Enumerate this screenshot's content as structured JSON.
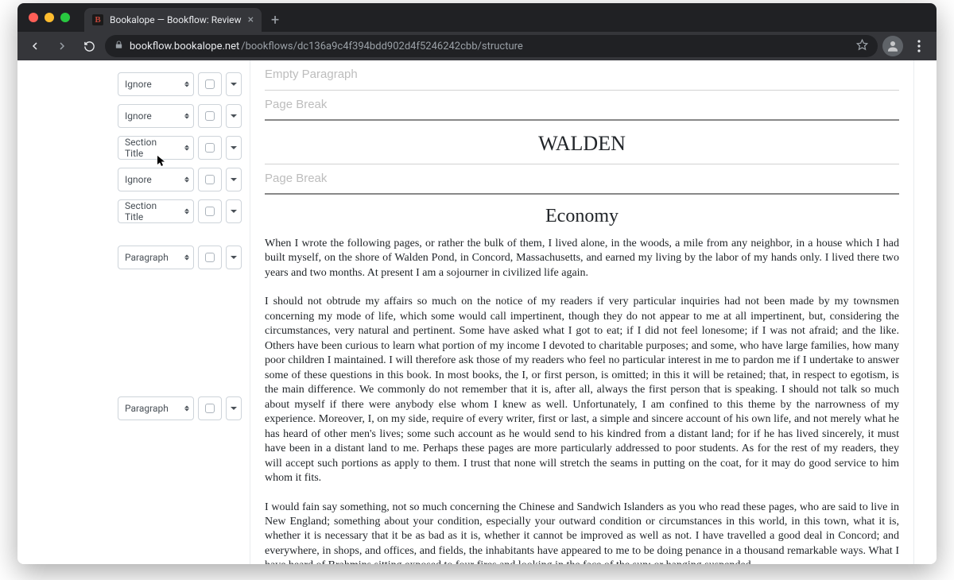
{
  "browser": {
    "tab_title": "Bookalope — Bookflow: Review",
    "url_host": "bookflow.bookalope.net",
    "url_path": "/bookflows/dc136a9c4f394bdd902d4f5246242cbb/structure"
  },
  "sidebar": {
    "rows": [
      {
        "label": "Ignore"
      },
      {
        "label": "Ignore"
      },
      {
        "label": "Section Title"
      },
      {
        "label": "Ignore"
      },
      {
        "label": "Section Title"
      },
      {
        "label": "Paragraph"
      },
      {
        "label": "Paragraph"
      }
    ]
  },
  "doc": {
    "empty_para_label": "Empty Paragraph",
    "page_break_label": "Page Break",
    "book_title": "WALDEN",
    "chapter_title": "Economy",
    "para1": "When I wrote the following pages, or rather the bulk of them, I lived alone, in the woods, a mile from any neighbor, in a house which I had built myself, on the shore of Walden Pond, in Concord, Massachusetts, and earned my living by the labor of my hands only. I lived there two years and two months. At present I am a sojourner in civilized life again.",
    "para2": "I should not obtrude my affairs so much on the notice of my readers if very particular inquiries had not been made by my townsmen concerning my mode of life, which some would call impertinent, though they do not appear to me at all impertinent, but, considering the circumstances, very natural and pertinent. Some have asked what I got to eat; if I did not feel lonesome; if I was not afraid; and the like. Others have been curious to learn what portion of my income I devoted to charitable purposes; and some, who have large families, how many poor children I maintained. I will therefore ask those of my readers who feel no particular interest in me to pardon me if I undertake to answer some of these questions in this book. In most books, the I, or first person, is omitted; in this it will be retained; that, in respect to egotism, is the main difference. We commonly do not remember that it is, after all, always the first person that is speaking. I should not talk so much about myself if there were anybody else whom I knew as well. Unfortunately, I am confined to this theme by the narrowness of my experience. Moreover, I, on my side, require of every writer, first or last, a simple and sincere account of his own life, and not merely what he has heard of other men's lives; some such account as he would send to his kindred from a distant land; for if he has lived sincerely, it must have been in a distant land to me. Perhaps these pages are more particularly addressed to poor students. As for the rest of my readers, they will accept such portions as apply to them. I trust that none will stretch the seams in putting on the coat, for it may do good service to him whom it fits.",
    "para3": "I would fain say something, not so much concerning the Chinese and Sandwich Islanders as you who read these pages, who are said to live in New England; something about your condition, especially your outward condition or circumstances in this world, in this town, what it is, whether it is necessary that it be as bad as it is, whether it cannot be improved as well as not. I have travelled a good deal in Concord; and everywhere, in shops, and offices, and fields, the inhabitants have appeared to me to be doing penance in a thousand remarkable ways. What I have heard of Brahmins sitting exposed to four fires and looking in the face of the sun; or hanging suspended,"
  }
}
